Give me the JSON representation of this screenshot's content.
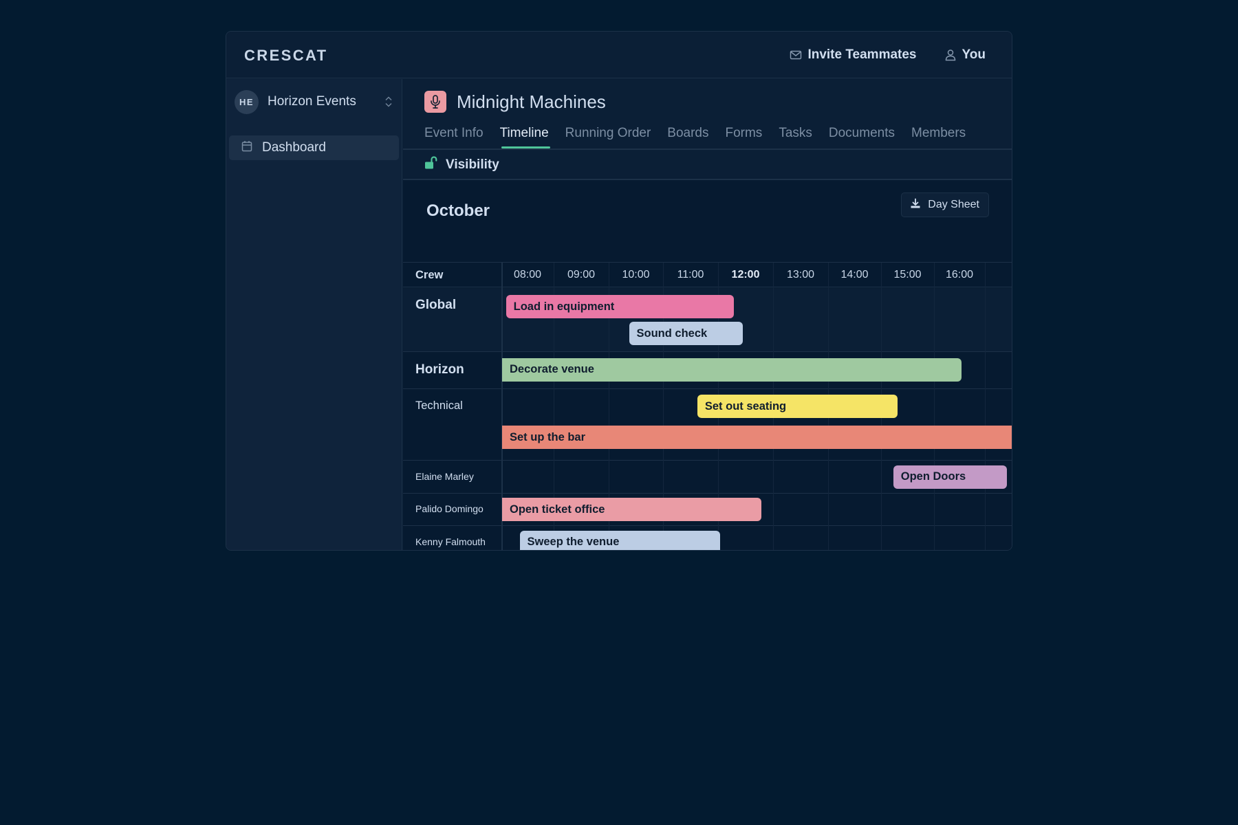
{
  "app": {
    "logo": "CRESCAT",
    "invite_label": "Invite Teammates",
    "user_label": "You"
  },
  "sidebar": {
    "org_initials": "HE",
    "org_name": "Horizon Events",
    "items": [
      {
        "label": "Dashboard",
        "icon": "calendar-icon",
        "active": true
      }
    ]
  },
  "event": {
    "name": "Midnight Machines",
    "icon": "microphone-icon",
    "icon_color": "#ea9aa2",
    "tabs": [
      {
        "label": "Event Info",
        "active": false
      },
      {
        "label": "Timeline",
        "active": true
      },
      {
        "label": "Running Order",
        "active": false
      },
      {
        "label": "Boards",
        "active": false
      },
      {
        "label": "Forms",
        "active": false
      },
      {
        "label": "Tasks",
        "active": false
      },
      {
        "label": "Documents",
        "active": false
      },
      {
        "label": "Members",
        "active": false
      }
    ],
    "visibility_label": "Visibility",
    "visibility_icon": "unlocked-icon"
  },
  "timeline": {
    "month": "October",
    "day_sheet_label": "Day Sheet",
    "crew_header": "Crew",
    "hours": [
      "08:00",
      "09:00",
      "10:00",
      "11:00",
      "12:00",
      "13:00",
      "14:00",
      "15:00",
      "16:00"
    ],
    "current_hour": "12:00",
    "rows": [
      {
        "name": "Global",
        "kind": "group",
        "tasks": [
          {
            "label": "Load in equipment",
            "start": "08:05",
            "end": "12:15",
            "color": "#e978a6"
          },
          {
            "label": "Sound check",
            "start": "10:20",
            "end": "12:25",
            "color": "#bccde4"
          }
        ]
      },
      {
        "name": "Horizon",
        "kind": "group-large",
        "tasks": [
          {
            "label": "Decorate venue",
            "start": "08:00",
            "end": "16:25",
            "color": "#9fc9a0"
          }
        ]
      },
      {
        "name": "Technical",
        "kind": "group-small",
        "tasks": [
          {
            "label": "Set out seating",
            "start": "11:35",
            "end": "15:15",
            "color": "#f5e466"
          },
          {
            "label": "Set up the bar",
            "start": "08:00",
            "end": "17:30",
            "color": "#e88777"
          }
        ]
      },
      {
        "name": "Elaine Marley",
        "kind": "person",
        "tasks": [
          {
            "label": "Open Doors",
            "start": "15:10",
            "end": "17:15",
            "color": "#c39ac6"
          }
        ]
      },
      {
        "name": "Palido Domingo",
        "kind": "person",
        "tasks": [
          {
            "label": "Open ticket office",
            "start": "08:00",
            "end": "12:45",
            "color": "#ea9ca5"
          }
        ]
      },
      {
        "name": "Kenny Falmouth",
        "kind": "person",
        "tasks": [
          {
            "label": "Sweep the venue",
            "start": "08:20",
            "end": "12:00",
            "color": "#bccde4"
          }
        ]
      }
    ]
  }
}
